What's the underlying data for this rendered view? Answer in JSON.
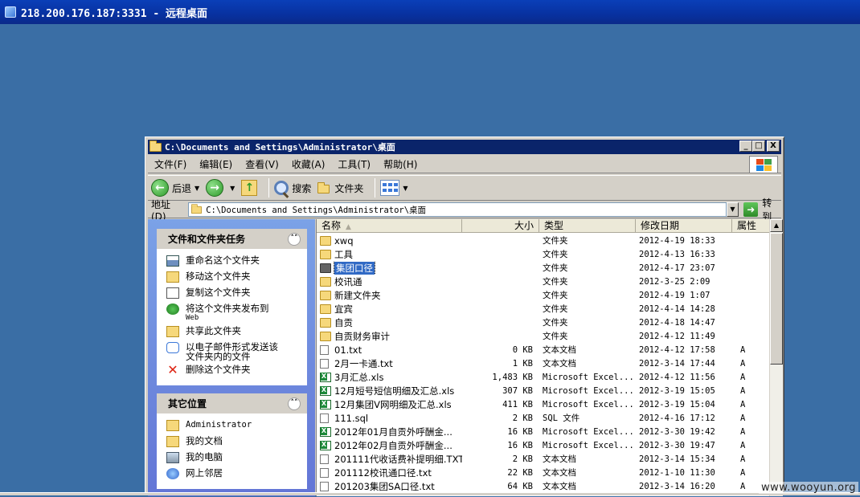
{
  "rdp": {
    "title": "218.200.176.187:3331 - 远程桌面"
  },
  "window": {
    "title": "C:\\Documents and Settings\\Administrator\\桌面",
    "buttons": {
      "minimize": "_",
      "maximize": "□",
      "close": "X"
    }
  },
  "menu": {
    "items": [
      {
        "label": "文件(F)"
      },
      {
        "label": "编辑(E)"
      },
      {
        "label": "查看(V)"
      },
      {
        "label": "收藏(A)"
      },
      {
        "label": "工具(T)"
      },
      {
        "label": "帮助(H)"
      }
    ]
  },
  "toolbar": {
    "back_label": "后退",
    "search_label": "搜索",
    "folders_label": "文件夹"
  },
  "address": {
    "label": "地址(D)",
    "value": "C:\\Documents and Settings\\Administrator\\桌面",
    "go_label": "转到"
  },
  "taskpane": {
    "tasks_title": "文件和文件夹任务",
    "tasks": [
      {
        "label": "重命名这个文件夹",
        "icon": "rename-icon"
      },
      {
        "label": "移动这个文件夹",
        "icon": "move-icon"
      },
      {
        "label": "复制这个文件夹",
        "icon": "copy-icon"
      },
      {
        "label": "将这个文件夹发布到",
        "sub": "Web",
        "icon": "publish-web-icon"
      },
      {
        "label": "共享此文件夹",
        "icon": "share-icon"
      },
      {
        "label": "以电子邮件形式发送该文件夹内的文件",
        "icon": "email-icon"
      },
      {
        "label": "删除这个文件夹",
        "icon": "delete-icon"
      }
    ],
    "places_title": "其它位置",
    "places": [
      {
        "label": "Administrator",
        "icon": "folder-icon"
      },
      {
        "label": "我的文档",
        "icon": "my-documents-icon"
      },
      {
        "label": "我的电脑",
        "icon": "my-computer-icon"
      },
      {
        "label": "网上邻居",
        "icon": "network-icon"
      }
    ]
  },
  "filelist": {
    "columns": {
      "name": "名称",
      "size": "大小",
      "type": "类型",
      "date": "修改日期",
      "attr": "属性"
    },
    "rows": [
      {
        "name": "xwq",
        "size": "",
        "type": "文件夹",
        "date": "2012-4-19 18:33",
        "attr": "",
        "icon": "folder"
      },
      {
        "name": "工具",
        "size": "",
        "type": "文件夹",
        "date": "2012-4-13 16:33",
        "attr": "",
        "icon": "folder"
      },
      {
        "name": "集团口径",
        "size": "",
        "type": "文件夹",
        "date": "2012-4-17 23:07",
        "attr": "",
        "icon": "folder",
        "selected": true
      },
      {
        "name": "校讯通",
        "size": "",
        "type": "文件夹",
        "date": "2012-3-25 2:09",
        "attr": "",
        "icon": "folder"
      },
      {
        "name": "新建文件夹",
        "size": "",
        "type": "文件夹",
        "date": "2012-4-19 1:07",
        "attr": "",
        "icon": "folder"
      },
      {
        "name": "宜宾",
        "size": "",
        "type": "文件夹",
        "date": "2012-4-14 14:28",
        "attr": "",
        "icon": "folder"
      },
      {
        "name": "自贡",
        "size": "",
        "type": "文件夹",
        "date": "2012-4-18 14:47",
        "attr": "",
        "icon": "folder"
      },
      {
        "name": "自贡财务审计",
        "size": "",
        "type": "文件夹",
        "date": "2012-4-12 11:49",
        "attr": "",
        "icon": "folder"
      },
      {
        "name": "01.txt",
        "size": "0 KB",
        "type": "文本文档",
        "date": "2012-4-12 17:58",
        "attr": "A",
        "icon": "txt"
      },
      {
        "name": "2月一卡通.txt",
        "size": "1 KB",
        "type": "文本文档",
        "date": "2012-3-14 17:44",
        "attr": "A",
        "icon": "txt"
      },
      {
        "name": "3月汇总.xls",
        "size": "1,483 KB",
        "type": "Microsoft Excel...",
        "date": "2012-4-12 11:56",
        "attr": "A",
        "icon": "xls"
      },
      {
        "name": "12月短号短信明细及汇总.xls",
        "size": "307 KB",
        "type": "Microsoft Excel...",
        "date": "2012-3-19 15:05",
        "attr": "A",
        "icon": "xls"
      },
      {
        "name": "12月集团V网明细及汇总.xls",
        "size": "411 KB",
        "type": "Microsoft Excel...",
        "date": "2012-3-19 15:04",
        "attr": "A",
        "icon": "xls"
      },
      {
        "name": "111.sql",
        "size": "2 KB",
        "type": "SQL 文件",
        "date": "2012-4-16 17:12",
        "attr": "A",
        "icon": "sql"
      },
      {
        "name": "2012年01月自贡外呼酬金...",
        "size": "16 KB",
        "type": "Microsoft Excel...",
        "date": "2012-3-30 19:42",
        "attr": "A",
        "icon": "xls"
      },
      {
        "name": "2012年02月自贡外呼酬金...",
        "size": "16 KB",
        "type": "Microsoft Excel...",
        "date": "2012-3-30 19:47",
        "attr": "A",
        "icon": "xls"
      },
      {
        "name": "201111代收话费补提明细.TXT",
        "size": "2 KB",
        "type": "文本文档",
        "date": "2012-3-14 15:34",
        "attr": "A",
        "icon": "txt"
      },
      {
        "name": "201112校讯通口径.txt",
        "size": "22 KB",
        "type": "文本文档",
        "date": "2012-1-10 11:30",
        "attr": "A",
        "icon": "txt"
      },
      {
        "name": "201203集团SA口径.txt",
        "size": "64 KB",
        "type": "文本文档",
        "date": "2012-3-14 16:20",
        "attr": "A",
        "icon": "txt"
      }
    ]
  },
  "watermark": "www.wooyun.org"
}
